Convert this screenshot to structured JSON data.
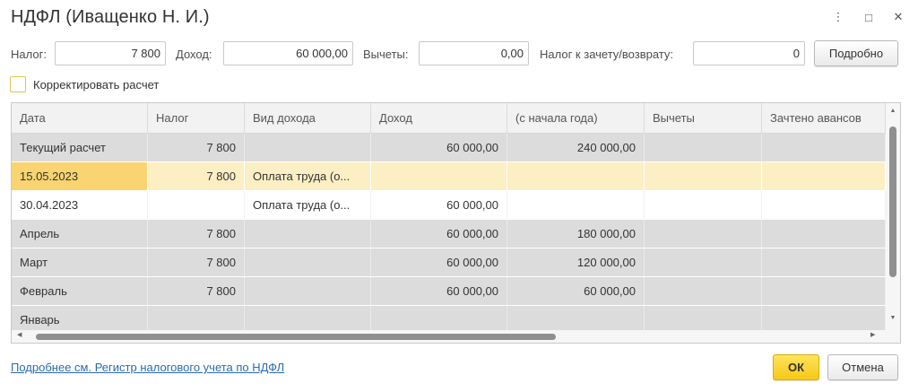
{
  "window": {
    "title": "НДФЛ (Иващенко Н. И.)",
    "more_icon": "⋮",
    "maximize_icon": "□",
    "close_icon": "✕"
  },
  "summary": {
    "tax_label": "Налог:",
    "tax_value": "7 800",
    "income_label": "Доход:",
    "income_value": "60 000,00",
    "deductions_label": "Вычеты:",
    "deductions_value": "0,00",
    "offset_label": "Налог к зачету/возврату:",
    "offset_value": "0",
    "detail_button": "Подробно"
  },
  "adjust": {
    "label": "Корректировать расчет",
    "checked": false
  },
  "table": {
    "columns": [
      "Дата",
      "Налог",
      "Вид дохода",
      "Доход",
      "(с начала года)",
      "Вычеты",
      "Зачтено авансов"
    ],
    "rows": [
      {
        "style": "gray",
        "cells": [
          "Текущий расчет",
          "7 800",
          "",
          "60 000,00",
          "240 000,00",
          "",
          ""
        ]
      },
      {
        "style": "sel",
        "cells": [
          "15.05.2023",
          "7 800",
          "Оплата труда (о...",
          "",
          "",
          "",
          ""
        ]
      },
      {
        "style": "white",
        "cells": [
          "30.04.2023",
          "",
          "Оплата труда (о...",
          "60 000,00",
          "",
          "",
          ""
        ]
      },
      {
        "style": "gray",
        "cells": [
          "Апрель",
          "7 800",
          "",
          "60 000,00",
          "180 000,00",
          "",
          ""
        ]
      },
      {
        "style": "gray",
        "cells": [
          "Март",
          "7 800",
          "",
          "60 000,00",
          "120 000,00",
          "",
          ""
        ]
      },
      {
        "style": "gray",
        "cells": [
          "Февраль",
          "7 800",
          "",
          "60 000,00",
          "60 000,00",
          "",
          ""
        ]
      },
      {
        "style": "gray",
        "cells": [
          "Январь",
          "",
          "",
          "",
          "",
          "",
          ""
        ]
      }
    ]
  },
  "footer": {
    "link": "Подробнее см. Регистр налогового учета по НДФЛ",
    "ok_button": "ОК",
    "cancel_button": "Отмена"
  },
  "colors": {
    "accent": "#f7c917",
    "selected_row": "#fcefc4",
    "focused_cell": "#f9d470",
    "link": "#2a6bb0"
  }
}
